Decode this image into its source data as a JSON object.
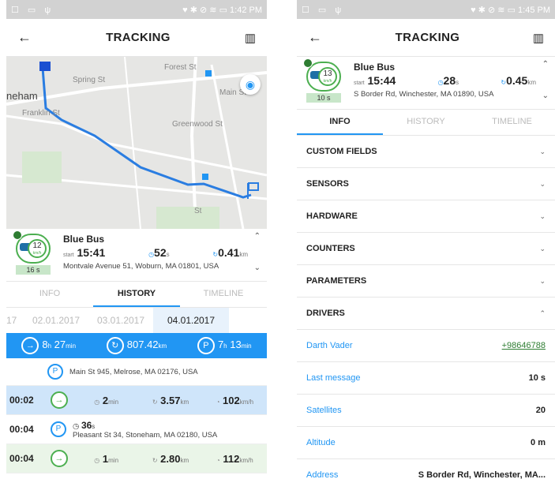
{
  "left": {
    "status": {
      "icons": "☐ ▭ ψ",
      "right": "♥ ✱ ⊘ ≋ ▭ 1:42 PM"
    },
    "appbar": {
      "title": "TRACKING"
    },
    "map": {
      "streets": [
        "Forest St",
        "Spring St",
        "neham",
        "Franklin St",
        "Greenwood St",
        "Main St",
        "St"
      ]
    },
    "unit": {
      "name": "Blue Bus",
      "speed": "12",
      "speed_unit": "km/h",
      "start_label": "start",
      "time": "15:41",
      "duration": "52",
      "duration_unit": "s",
      "distance": "0.41",
      "distance_unit": "km",
      "address": "Montvale Avenue 51, Woburn, MA 01801, USA",
      "timer": "16 s"
    },
    "tabs": [
      "INFO",
      "HISTORY",
      "TIMELINE"
    ],
    "dates": [
      "17",
      "02.01.2017",
      "03.01.2017",
      "04.01.2017"
    ],
    "summary": {
      "trips_h": "8",
      "trips_min": "27",
      "dist": "807.42",
      "dist_unit": "km",
      "park_h": "7",
      "park_min": "13",
      "h_unit": "h",
      "min_unit": "min"
    },
    "history": {
      "parking1": "Main St 945, Melrose, MA 02176, USA",
      "trip1": {
        "time": "00:02",
        "duration": "2",
        "dur_unit": "min",
        "dist": "3.57",
        "dist_unit": "km",
        "speed": "102",
        "speed_unit": "km/h"
      },
      "stop1": {
        "time": "00:04",
        "duration": "36",
        "dur_unit": "s",
        "address": "Pleasant St 34, Stoneham, MA 02180, USA"
      },
      "trip2": {
        "time": "00:04",
        "duration": "1",
        "dur_unit": "min",
        "dist": "2.80",
        "dist_unit": "km",
        "speed": "112",
        "speed_unit": "km/h"
      }
    }
  },
  "right": {
    "status": {
      "icons": "☐ ▭ ψ",
      "right": "♥ ✱ ⊘ ≋ ▭ 1:45 PM"
    },
    "appbar": {
      "title": "TRACKING"
    },
    "unit": {
      "name": "Blue Bus",
      "speed": "13",
      "speed_unit": "km/h",
      "start_label": "start",
      "time": "15:44",
      "duration": "28",
      "duration_unit": "s",
      "distance": "0.45",
      "distance_unit": "km",
      "address": "S Border Rd, Winchester, MA 01890, USA",
      "timer": "10 s"
    },
    "tabs": [
      "INFO",
      "HISTORY",
      "TIMELINE"
    ],
    "sections": [
      "CUSTOM FIELDS",
      "SENSORS",
      "HARDWARE",
      "COUNTERS",
      "PARAMETERS",
      "DRIVERS"
    ],
    "driver": {
      "name": "Darth Vader",
      "phone": "+98646788"
    },
    "fields": [
      {
        "k": "Last message",
        "v": "10 s"
      },
      {
        "k": "Satellites",
        "v": "20"
      },
      {
        "k": "Altitude",
        "v": "0 m"
      },
      {
        "k": "Address",
        "v": "S Border Rd, Winchester, MA..."
      }
    ]
  },
  "colors": {
    "accent": "#2196f3",
    "green": "#4caf50",
    "route": "#2a7de1"
  }
}
